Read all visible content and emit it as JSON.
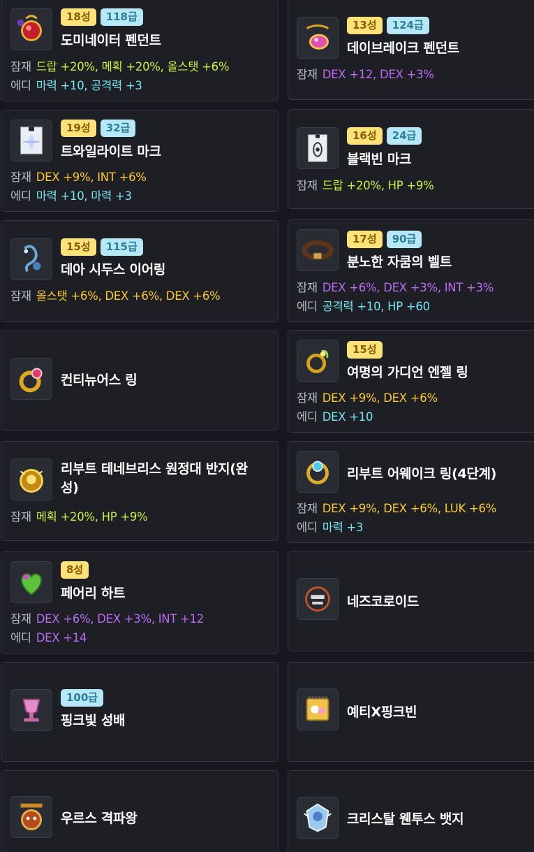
{
  "labels": {
    "potential": "잠재",
    "additional": "에디"
  },
  "items": [
    {
      "name": "도미네이터 펜던트",
      "star": "18성",
      "grade": "118급",
      "icon": "dominator-pendant-icon",
      "potential": "드랍 +20%, 메획 +20%, 올스탯 +6%",
      "additional": "마력 +10, 공격력 +3"
    },
    {
      "name": "데이브레이크 펜던트",
      "star": "13성",
      "grade": "124급",
      "icon": "daybreak-pendant-icon",
      "potential": "DEX +12, DEX +3%"
    },
    {
      "name": "트와일라이트 마크",
      "star": "19성",
      "grade": "32급",
      "icon": "twilight-mark-icon",
      "potential": "DEX +9%, INT +6%",
      "additional": "마력 +10, 마력 +3"
    },
    {
      "name": "블랙빈 마크",
      "star": "16성",
      "grade": "24급",
      "icon": "black-bean-mark-icon",
      "potential": "드랍 +20%, HP +9%"
    },
    {
      "name": "데아 시두스 이어링",
      "star": "15성",
      "grade": "115급",
      "icon": "dea-sidus-earring-icon",
      "potential": "올스탯 +6%, DEX +6%, DEX +6%"
    },
    {
      "name": "분노한 자쿰의 벨트",
      "star": "17성",
      "grade": "90급",
      "icon": "zakum-belt-icon",
      "potential": "DEX +6%, DEX +3%, INT +3%",
      "additional": "공격력 +10, HP +60"
    },
    {
      "name": "컨티뉴어스 링",
      "icon": "continuous-ring-icon"
    },
    {
      "name": "여명의 가디언 엔젤 링",
      "star": "15성",
      "icon": "guardian-angel-ring-icon",
      "potential": "DEX +9%, DEX +6%",
      "additional": "DEX +10"
    },
    {
      "name": "리부트 테네브리스 원정대 반지(완성)",
      "icon": "tenebris-ring-icon",
      "potential": "메획 +20%, HP +9%"
    },
    {
      "name": "리부트 어웨이크 링(4단계)",
      "icon": "awake-ring-icon",
      "potential": "DEX +9%, DEX +6%, LUK +6%",
      "additional": "마력 +3"
    },
    {
      "name": "페어리 하트",
      "star": "8성",
      "icon": "fairy-heart-icon",
      "potential": "DEX +6%, DEX +3%, INT +12",
      "additional": "DEX +14"
    },
    {
      "name": "네즈코로이드",
      "icon": "nezcoroid-icon"
    },
    {
      "name": "핑크빛 성배",
      "grade": "100급",
      "icon": "pink-holy-cup-icon"
    },
    {
      "name": "예티X핑크빈",
      "icon": "yeti-pinkbean-icon"
    },
    {
      "name": "우르스 격파왕",
      "icon": "urus-medal-icon"
    },
    {
      "name": "크리스탈 웬투스 뱃지",
      "icon": "crystal-ventus-badge-icon"
    }
  ],
  "colors": {
    "yellow_green": "#ccef3d",
    "yellow": "#fccb2a",
    "purple": "#bb6cf3",
    "cyan": "#76e4f0",
    "star_badge": "#fde27a",
    "grade_badge": "#b6e8f7"
  }
}
